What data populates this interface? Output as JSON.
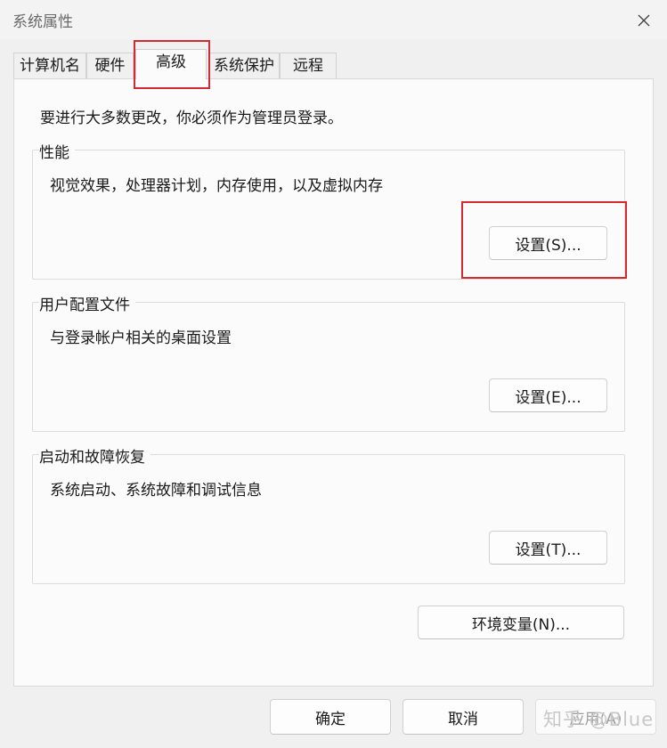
{
  "window": {
    "title": "系统属性"
  },
  "tabs": [
    {
      "label": "计算机名"
    },
    {
      "label": "硬件"
    },
    {
      "label": "高级"
    },
    {
      "label": "系统保护"
    },
    {
      "label": "远程"
    }
  ],
  "notice": "要进行大多数更改，你必须作为管理员登录。",
  "performance": {
    "title": "性能",
    "description": "视觉效果，处理器计划，内存使用，以及虚拟内存",
    "button": "设置(S)..."
  },
  "user_profiles": {
    "title": "用户配置文件",
    "description": "与登录帐户相关的桌面设置",
    "button": "设置(E)..."
  },
  "startup_recovery": {
    "title": "启动和故障恢复",
    "description": "系统启动、系统故障和调试信息",
    "button": "设置(T)..."
  },
  "env_button": "环境变量(N)...",
  "footer": {
    "ok": "确定",
    "cancel": "取消",
    "apply": "应用(A)"
  },
  "watermark": "知乎 @Blue",
  "colors": {
    "highlight": "#d42b33"
  }
}
